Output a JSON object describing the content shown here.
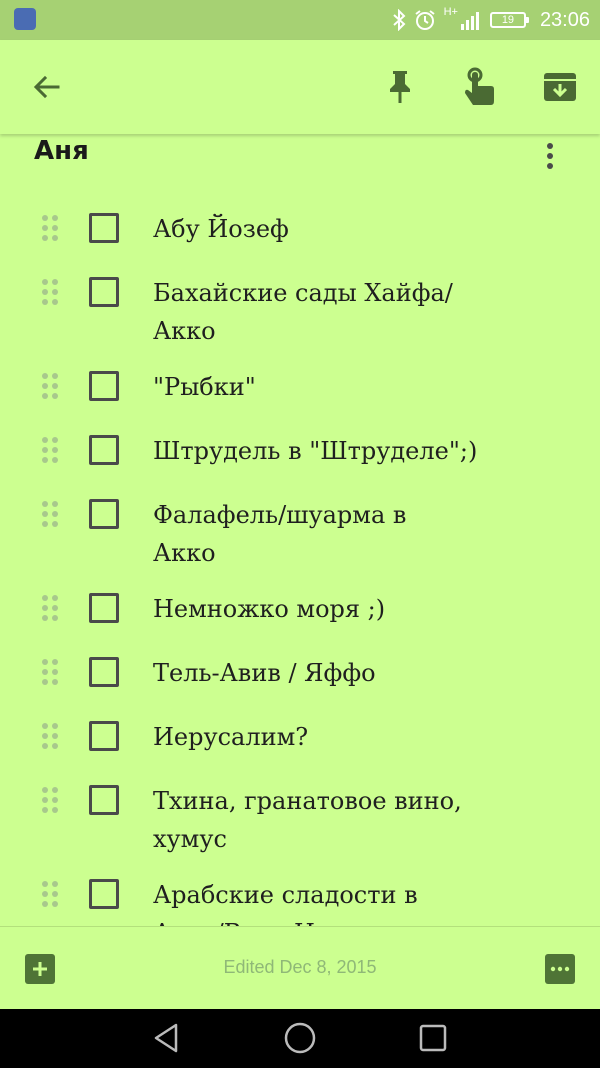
{
  "status_bar": {
    "time": "23:06",
    "battery": "19",
    "network": "H+"
  },
  "toolbar": {
    "back_icon": "arrow-left-icon",
    "pin_icon": "pin-icon",
    "reminder_icon": "reminder-finger-icon",
    "archive_icon": "archive-icon"
  },
  "note": {
    "title": "Аня",
    "items": [
      {
        "text": "Абу Йозеф",
        "checked": false
      },
      {
        "text": "Бахайские сады Хайфа/ Акко",
        "checked": false
      },
      {
        "text": "\"Рыбки\"",
        "checked": false
      },
      {
        "text": "Штрудель в \"Штруделе\";)",
        "checked": false
      },
      {
        "text": "Фалафель/шуарма в Акко",
        "checked": false
      },
      {
        "text": "Немножко моря ;)",
        "checked": false
      },
      {
        "text": "Тель-Авив / Яффо",
        "checked": false
      },
      {
        "text": "Иерусалим?",
        "checked": false
      },
      {
        "text": "Тхина, гранатовое вино, хумус",
        "checked": false
      },
      {
        "text": "Арабские сладости в Акко/Вади Ниснас",
        "checked": false
      }
    ]
  },
  "bottom_bar": {
    "edited": "Edited Dec 8, 2015"
  },
  "colors": {
    "background": "#CCFF90",
    "status_bar": "#A6D173",
    "accent": "#4f7436",
    "icon": "#4a6a33"
  }
}
